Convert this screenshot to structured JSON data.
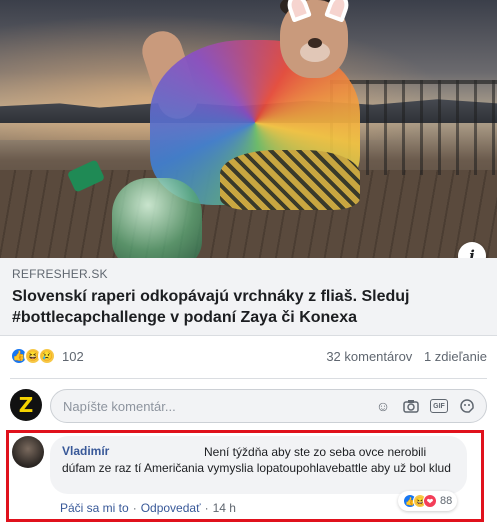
{
  "media": {
    "info_icon": "info-icon",
    "info_label": "i"
  },
  "link_preview": {
    "domain": "REFRESHER.SK",
    "title": "Slovenskí raperi odkopávajú vrchnáky z fliaš. Sleduj #bottlecapchallenge v podaní Zaya či Konexa"
  },
  "reactions": {
    "icons": [
      "like-icon",
      "haha-icon",
      "sad-icon"
    ],
    "count": "102",
    "comments": "32 komentárov",
    "shares": "1 zdieľanie"
  },
  "composer": {
    "avatar_letter": "Z",
    "placeholder": "Napíšte komentár...",
    "tools": [
      "emoji-icon",
      "camera-icon",
      "gif-icon",
      "sticker-icon"
    ],
    "gif_label": "GIF"
  },
  "comment": {
    "author": "Vladimír",
    "text": "Není týždňa aby ste zo seba ovce nerobili dúfam ze raz tí Američania vymyslia lopatoupohlavebattle aby už bol klud",
    "reaction_count": "88",
    "reaction_icons": [
      "like-icon",
      "haha-icon",
      "love-icon"
    ],
    "like_label": "Páči sa mi to",
    "reply_label": "Odpovedať",
    "time": "14 h"
  },
  "colors": {
    "accent": "#385898",
    "highlight_border": "#e0111c",
    "like_blue": "#1877f2"
  }
}
